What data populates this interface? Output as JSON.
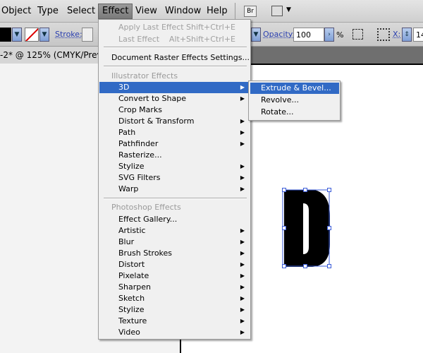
{
  "menubar": {
    "items": [
      "Object",
      "Type",
      "Select",
      "Effect",
      "View",
      "Window",
      "Help"
    ],
    "bridge_label": "Br"
  },
  "control_bar": {
    "stroke_label": "Stroke:",
    "opacity_label": "Opacity:",
    "opacity_value": "100",
    "percent": "%",
    "x_label": "X:",
    "x_value": "14"
  },
  "document_tab": {
    "title": "-2* @ 125% (CMYK/Prev"
  },
  "effect_menu": {
    "apply_last": {
      "label": "Apply Last Effect",
      "shortcut": "Shift+Ctrl+E"
    },
    "last": {
      "label": "Last Effect",
      "shortcut": "Alt+Shift+Ctrl+E"
    },
    "raster_settings": "Document Raster Effects Settings...",
    "illustrator_header": "Illustrator Effects",
    "illustrator_items": [
      {
        "label": "3D",
        "submenu": true
      },
      {
        "label": "Convert to Shape",
        "submenu": true
      },
      {
        "label": "Crop Marks",
        "submenu": false
      },
      {
        "label": "Distort & Transform",
        "submenu": true
      },
      {
        "label": "Path",
        "submenu": true
      },
      {
        "label": "Pathfinder",
        "submenu": true
      },
      {
        "label": "Rasterize...",
        "submenu": false
      },
      {
        "label": "Stylize",
        "submenu": true
      },
      {
        "label": "SVG Filters",
        "submenu": true
      },
      {
        "label": "Warp",
        "submenu": true
      }
    ],
    "photoshop_header": "Photoshop Effects",
    "photoshop_items": [
      {
        "label": "Effect Gallery...",
        "submenu": false
      },
      {
        "label": "Artistic",
        "submenu": true
      },
      {
        "label": "Blur",
        "submenu": true
      },
      {
        "label": "Brush Strokes",
        "submenu": true
      },
      {
        "label": "Distort",
        "submenu": true
      },
      {
        "label": "Pixelate",
        "submenu": true
      },
      {
        "label": "Sharpen",
        "submenu": true
      },
      {
        "label": "Sketch",
        "submenu": true
      },
      {
        "label": "Stylize",
        "submenu": true
      },
      {
        "label": "Texture",
        "submenu": true
      },
      {
        "label": "Video",
        "submenu": true
      }
    ]
  },
  "submenu_3d": {
    "items": [
      "Extrude & Bevel...",
      "Revolve...",
      "Rotate..."
    ]
  },
  "colors": {
    "highlight": "#316ac5",
    "selection": "#3a5bd8"
  }
}
